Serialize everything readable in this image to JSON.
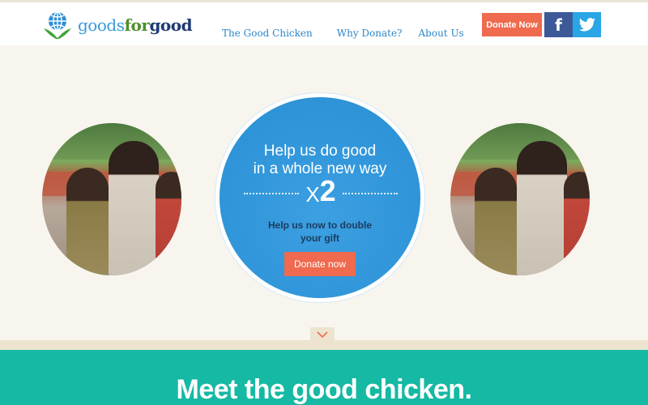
{
  "header": {
    "logo": {
      "part1": "goods",
      "part2": "for",
      "part3": "good",
      "icon": "globe-in-hands-icon"
    },
    "nav": [
      {
        "label": "The Good Chicken"
      },
      {
        "label": "Why Donate?"
      },
      {
        "label": "About Us"
      }
    ],
    "donate_label": "Donate Now",
    "social": {
      "facebook_glyph": "f",
      "twitter_icon": "twitter-icon"
    }
  },
  "hero": {
    "title_line1": "Help us do good",
    "title_line2": "in a whole new way",
    "multiplier_x": "X",
    "multiplier_num": "2",
    "sub_line1": "Help us now to double",
    "sub_line2": "your gift",
    "cta_label": "Donate now",
    "scroll_icon": "chevron-down-icon"
  },
  "band": {
    "title": "Meet the good chicken."
  },
  "colors": {
    "accent": "#ef6a4e",
    "hero_blue": "#2b97df",
    "teal": "#16b9a3",
    "facebook": "#3c5998",
    "twitter": "#2aa5e5"
  }
}
